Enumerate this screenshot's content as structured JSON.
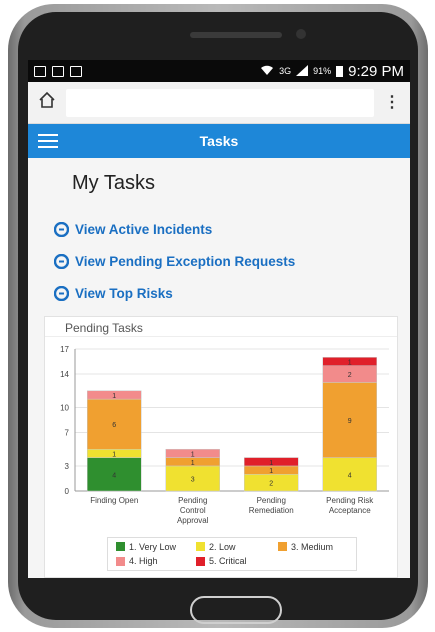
{
  "statusbar": {
    "network": "3G",
    "battery": "91%",
    "time": "9:29 PM"
  },
  "browser": {
    "url_placeholder": ""
  },
  "appbar": {
    "title": "Tasks"
  },
  "page": {
    "title": "My Tasks",
    "links": [
      {
        "label": "View Active Incidents"
      },
      {
        "label": "View Pending Exception Requests"
      },
      {
        "label": "View Top Risks"
      }
    ]
  },
  "panel": {
    "title": "Pending Tasks"
  },
  "colors": {
    "very_low": "#2f8f2f",
    "low": "#f0e130",
    "medium": "#f0a030",
    "high": "#f28b8b",
    "critical": "#e0202a",
    "accent": "#1e87d8"
  },
  "chart_data": {
    "type": "bar",
    "stacked": true,
    "categories": [
      "Finding Open",
      "Pending Control Approval",
      "Pending Remediation",
      "Pending Risk Acceptance"
    ],
    "category_lines": [
      [
        "Finding Open"
      ],
      [
        "Pending",
        "Control",
        "Approval"
      ],
      [
        "Pending",
        "Remediation"
      ],
      [
        "Pending Risk",
        "Acceptance"
      ]
    ],
    "series": [
      {
        "name": "1. Very Low",
        "values": [
          4,
          0,
          0,
          0
        ]
      },
      {
        "name": "2. Low",
        "values": [
          1,
          3,
          2,
          4
        ]
      },
      {
        "name": "3. Medium",
        "values": [
          6,
          1,
          1,
          9
        ]
      },
      {
        "name": "4. High",
        "values": [
          1,
          1,
          0,
          2
        ]
      },
      {
        "name": "5. Critical",
        "values": [
          0,
          0,
          1,
          1
        ]
      }
    ],
    "ylim": [
      0,
      17
    ],
    "yticks": [
      0,
      3,
      7,
      10,
      14,
      17
    ],
    "legend_position": "bottom",
    "grid": true
  }
}
